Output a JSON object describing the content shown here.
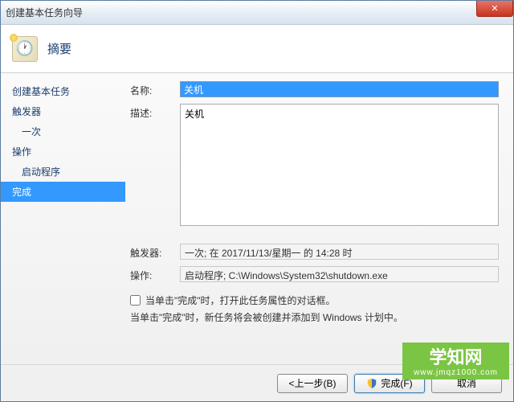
{
  "window": {
    "title": "创建基本任务向导",
    "close": "✕"
  },
  "header": {
    "title": "摘要"
  },
  "sidebar": {
    "steps": [
      {
        "label": "创建基本任务",
        "sub": false,
        "active": false
      },
      {
        "label": "触发器",
        "sub": false,
        "active": false
      },
      {
        "label": "一次",
        "sub": true,
        "active": false
      },
      {
        "label": "操作",
        "sub": false,
        "active": false
      },
      {
        "label": "启动程序",
        "sub": true,
        "active": false
      },
      {
        "label": "完成",
        "sub": false,
        "active": true
      }
    ]
  },
  "form": {
    "name_label": "名称:",
    "name_value": "关机",
    "desc_label": "描述:",
    "desc_value": "关机",
    "trigger_label": "触发器:",
    "trigger_value": "一次; 在 2017/11/13/星期一 的 14:28 时",
    "action_label": "操作:",
    "action_value": "启动程序; C:\\Windows\\System32\\shutdown.exe",
    "checkbox_label": "当单击\"完成\"时，打开此任务属性的对话框。",
    "info_text": "当单击\"完成\"时，新任务将会被创建并添加到 Windows 计划中。"
  },
  "footer": {
    "back": "<上一步(B)",
    "finish": "完成(F)",
    "cancel": "取消"
  },
  "watermark": {
    "main": "学知网",
    "sub": "www.jmqz1000.com"
  }
}
